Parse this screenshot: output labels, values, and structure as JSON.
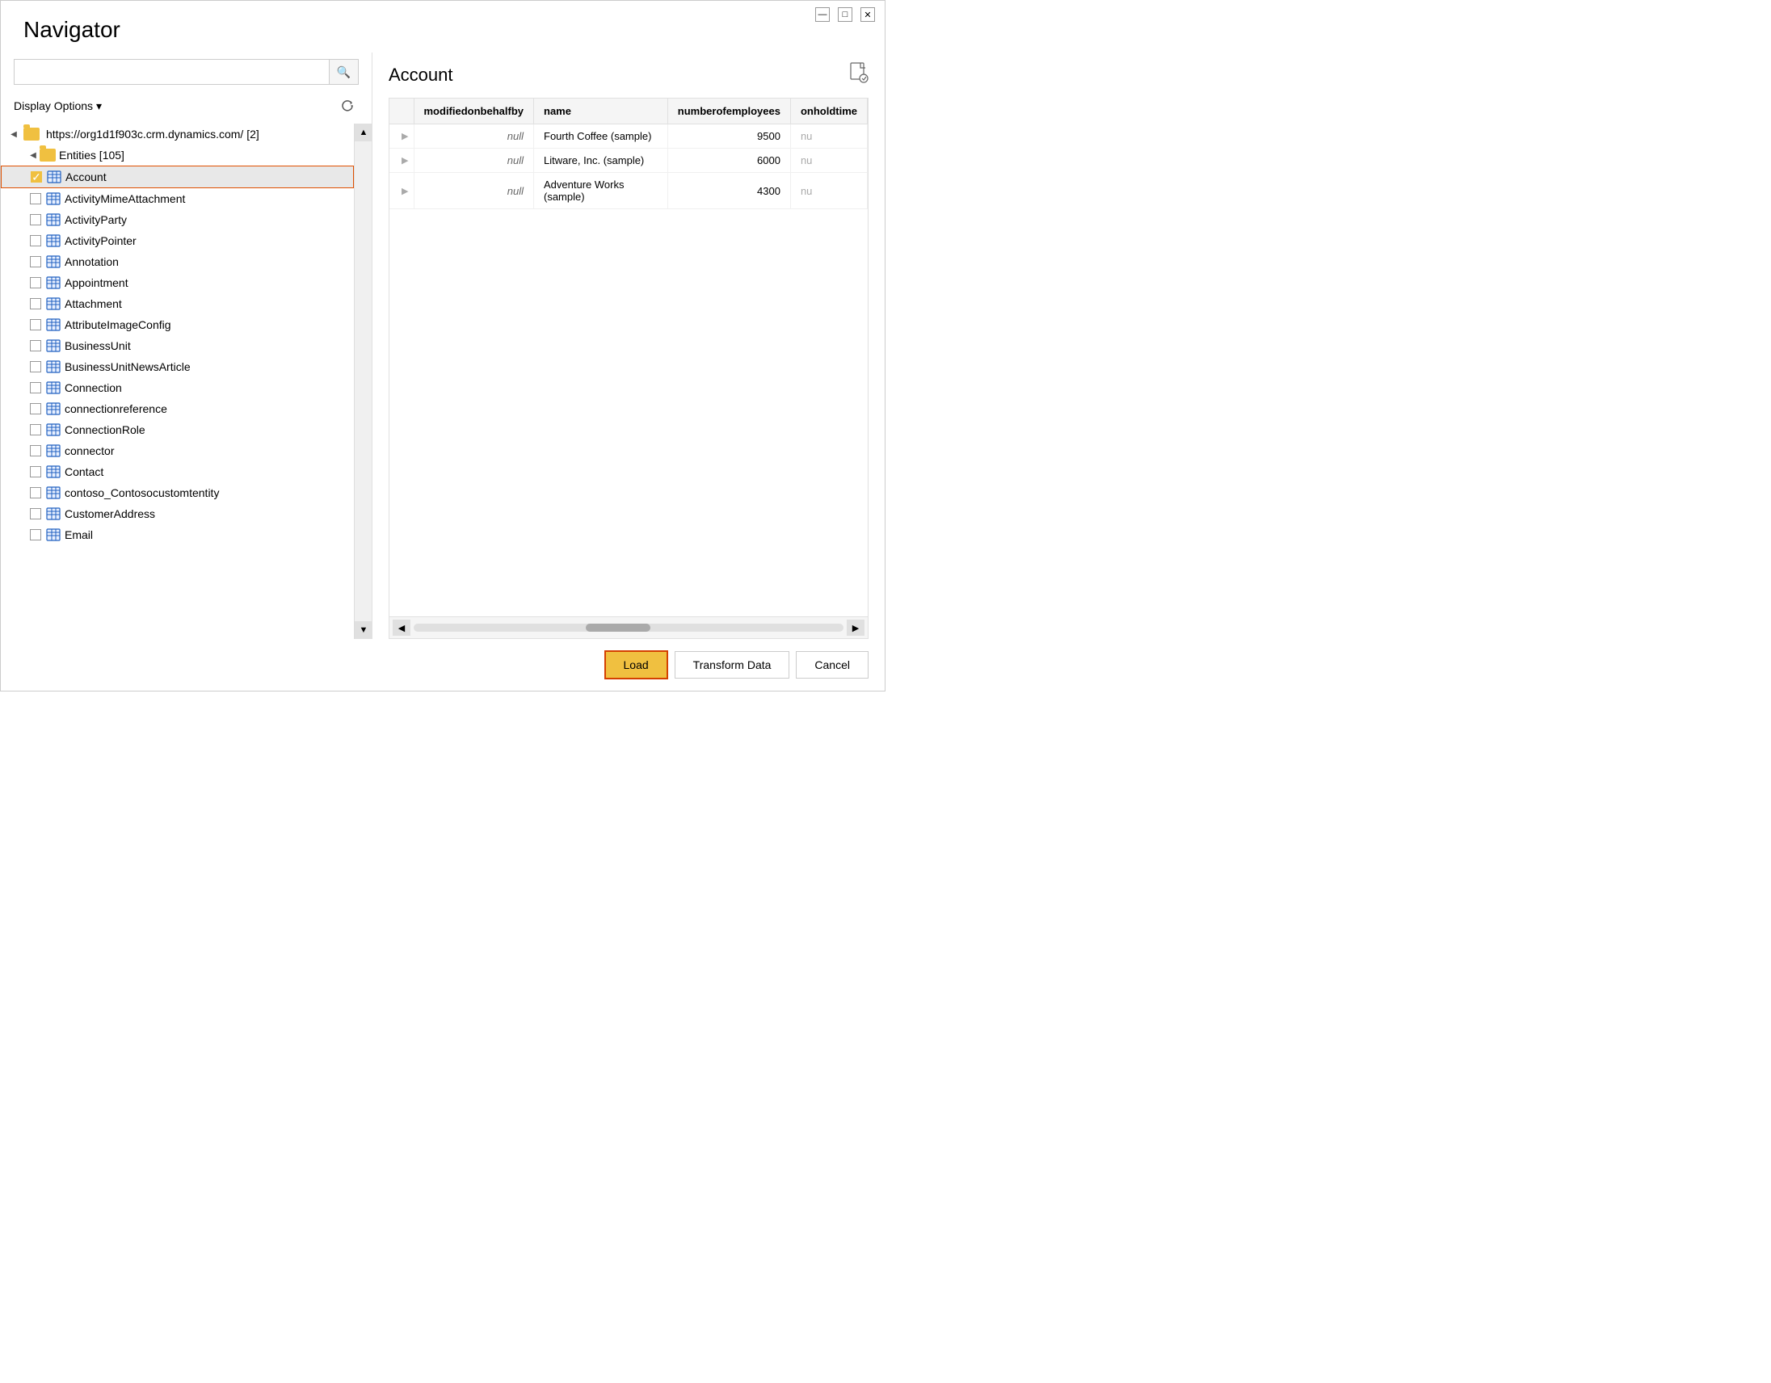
{
  "window": {
    "title": "Navigator"
  },
  "titleBar": {
    "minimize": "—",
    "maximize": "□",
    "close": "✕"
  },
  "search": {
    "placeholder": "",
    "searchIconLabel": "🔍"
  },
  "displayOptions": {
    "label": "Display Options",
    "arrow": "▾"
  },
  "tree": {
    "root": {
      "url": "https://org1d1f903c.crm.dynamics.com/ [2]",
      "expandIcon": "◀"
    },
    "entities": {
      "label": "Entities [105]",
      "expandIcon": "◀"
    },
    "items": [
      {
        "name": "Account",
        "checked": true
      },
      {
        "name": "ActivityMimeAttachment",
        "checked": false
      },
      {
        "name": "ActivityParty",
        "checked": false
      },
      {
        "name": "ActivityPointer",
        "checked": false
      },
      {
        "name": "Annotation",
        "checked": false
      },
      {
        "name": "Appointment",
        "checked": false
      },
      {
        "name": "Attachment",
        "checked": false
      },
      {
        "name": "AttributeImageConfig",
        "checked": false
      },
      {
        "name": "BusinessUnit",
        "checked": false
      },
      {
        "name": "BusinessUnitNewsArticle",
        "checked": false
      },
      {
        "name": "Connection",
        "checked": false
      },
      {
        "name": "connectionreference",
        "checked": false
      },
      {
        "name": "ConnectionRole",
        "checked": false
      },
      {
        "name": "connector",
        "checked": false
      },
      {
        "name": "Contact",
        "checked": false
      },
      {
        "name": "contoso_Contosocustomtentity",
        "checked": false
      },
      {
        "name": "CustomerAddress",
        "checked": false
      },
      {
        "name": "Email",
        "checked": false
      }
    ]
  },
  "preview": {
    "title": "Account",
    "columns": [
      {
        "key": "modifiedonbehalfby",
        "label": "modifiedonbehalfby"
      },
      {
        "key": "name",
        "label": "name"
      },
      {
        "key": "numberofemployees",
        "label": "numberofemployees"
      },
      {
        "key": "onholdtime",
        "label": "onholdtime"
      }
    ],
    "rows": [
      {
        "modifiedonbehalfby": "null",
        "name": "Fourth Coffee (sample)",
        "numberofemployees": "9500",
        "onholdtime": "nu"
      },
      {
        "modifiedonbehalfby": "null",
        "name": "Litware, Inc. (sample)",
        "numberofemployees": "6000",
        "onholdtime": "nu"
      },
      {
        "modifiedonbehalfby": "null",
        "name": "Adventure Works (sample)",
        "numberofemployees": "4300",
        "onholdtime": "nu"
      }
    ]
  },
  "footer": {
    "loadLabel": "Load",
    "transformLabel": "Transform Data",
    "cancelLabel": "Cancel"
  }
}
